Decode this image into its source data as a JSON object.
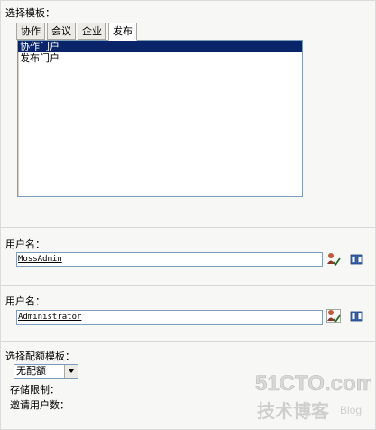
{
  "template": {
    "label": "选择模板：",
    "tabs": [
      "协作",
      "会议",
      "企业",
      "发布"
    ],
    "active_tab": "发布",
    "items": [
      "协作门户",
      "发布门户"
    ],
    "selected_item": "协作门户"
  },
  "user1": {
    "label": "用户名：",
    "value": "MossAdmin"
  },
  "user2": {
    "label": "用户名：",
    "value": "Administrator"
  },
  "quota": {
    "label": "选择配额模板：",
    "selected": "无配额",
    "storage_label": "存储限制：",
    "invite_label": "邀请用户数："
  },
  "watermark": {
    "line1": "51CTO.com",
    "line2": "技术博客",
    "line3": "Blog"
  },
  "colors": {
    "selection": "#0a246a",
    "field_border": "#7f9db9"
  },
  "icons": [
    "check-names-icon",
    "address-book-icon",
    "dropdown-arrow-icon"
  ]
}
